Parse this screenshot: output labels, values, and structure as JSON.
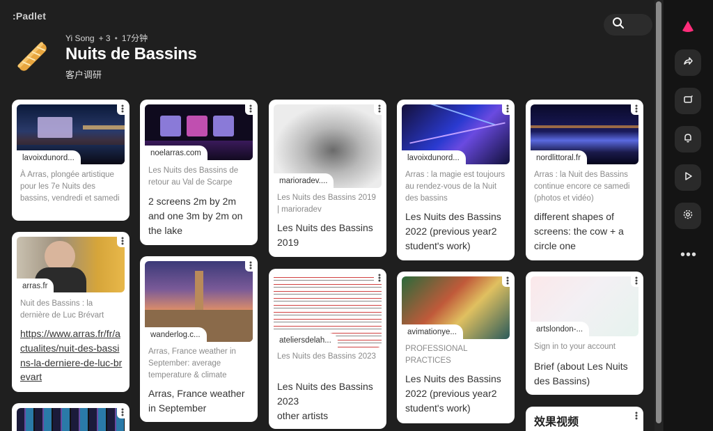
{
  "app": {
    "logo": ":Padlet"
  },
  "board": {
    "author": "Yi Song",
    "collaborators": "+ 3",
    "updated": "17分钟",
    "title": "Nuits de Bassins",
    "subtitle": "客户调研"
  },
  "icons": {
    "board": "baguette-icon",
    "search": "search-icon",
    "rail": [
      "padlet-drop-icon",
      "share-icon",
      "remake-icon",
      "bell-icon",
      "slideshow-icon",
      "settings-icon",
      "more-icon"
    ]
  },
  "colors": {
    "accent": "#ff2d7a",
    "background": "#1f1f1f",
    "card": "#ffffff"
  },
  "rail": {
    "more": "•••"
  },
  "cards": [
    {
      "source": "lavoixdunord...",
      "desc": "À Arras, plongée artistique pour les 7e Nuits des bassins, vendredi et samedi",
      "body": ""
    },
    {
      "source": "arras.fr",
      "desc": "Nuit des Bassins : la dernière de Luc Brévart",
      "body": "https://www.arras.fr/fr/actualites/nuit-des-bassins-la-derniere-de-luc-brevart"
    },
    {
      "source": "noelarras.com",
      "desc": "Les Nuits des Bassins de retour au Val de Scarpe",
      "body": "2 screens 2m by 2m and one 3m by 2m  on the lake"
    },
    {
      "source": "wanderlog.c...",
      "desc": "Arras, France weather in September: average temperature & climate",
      "body": "Arras, France weather in September"
    },
    {
      "source": "marioradev....",
      "desc": "Les Nuits des Bassins 2019 | marioradev",
      "body": "Les Nuits des Bassins 2019"
    },
    {
      "source": "ateliersdelah...",
      "desc": "Les Nuits des Bassins 2023",
      "body": "Les Nuits des Bassins 2023\nother artists"
    },
    {
      "source": "lavoixdunord...",
      "desc": "Arras : la magie est toujours au rendez-vous de la Nuit des bassins",
      "body": "Les Nuits des Bassins 2022 (previous year2 student's work)"
    },
    {
      "source": "avimationye...",
      "desc": "PROFESSIONAL PRACTICES",
      "body": "Les Nuits des Bassins 2022 (previous year2 student's work)"
    },
    {
      "source": "nordlittoral.fr",
      "desc": "Arras : la Nuit des Bassins continue encore ce samedi (photos et vidéo)",
      "body": "different shapes of screens: the cow + a circle one"
    },
    {
      "source": "artslondon-...",
      "desc": "Sign in to your account",
      "body": "Brief (about Les Nuits des Bassins)"
    },
    {
      "title": "效果视频"
    }
  ]
}
